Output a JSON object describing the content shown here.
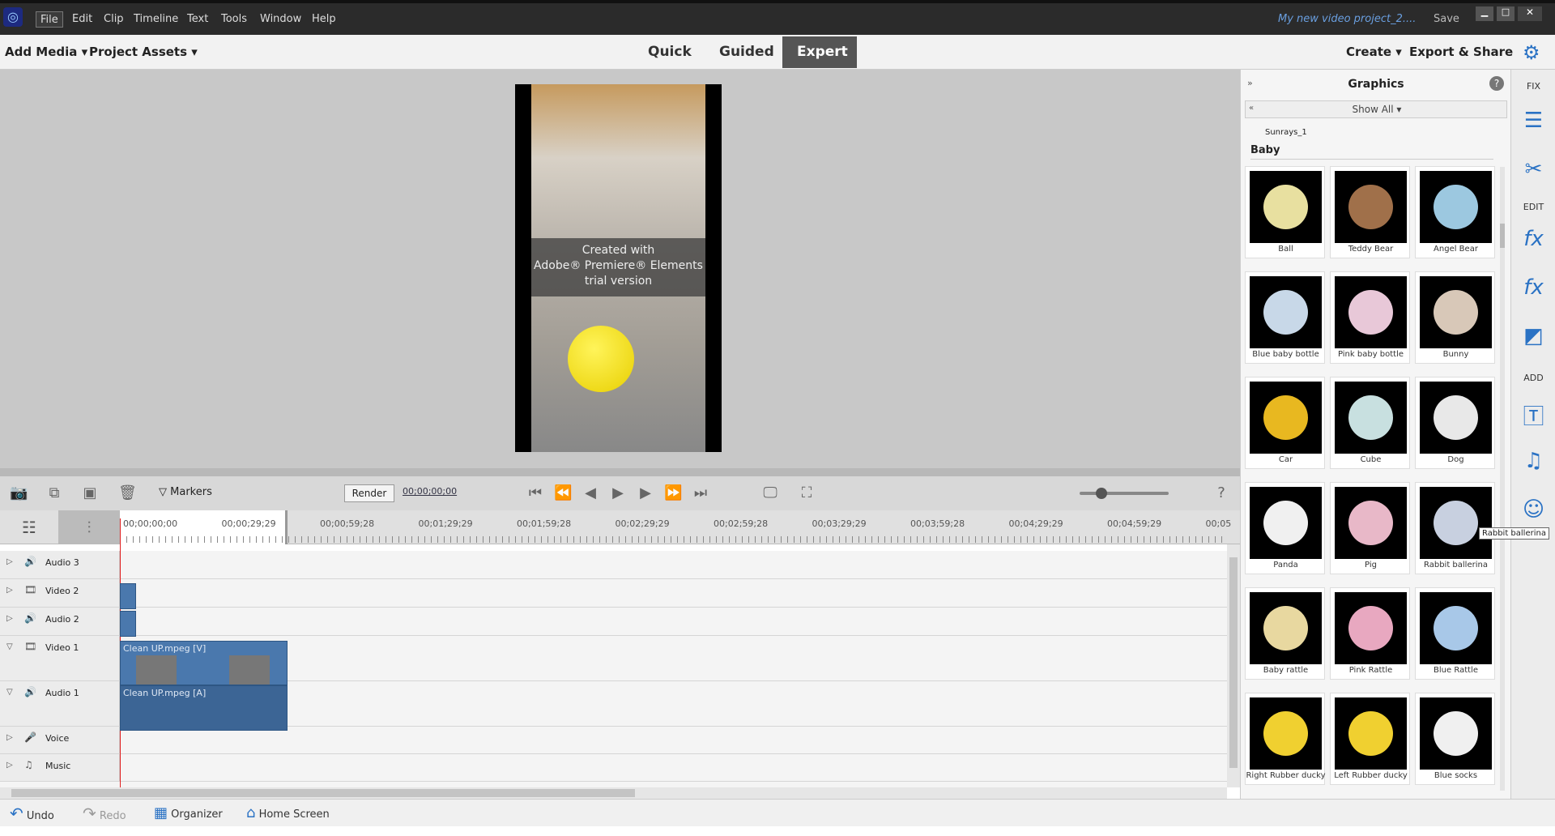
{
  "menu": [
    "File",
    "Edit",
    "Clip",
    "Timeline",
    "Text",
    "Tools",
    "Window",
    "Help"
  ],
  "title": {
    "project": "My new video project_2....",
    "save": "Save"
  },
  "toolbar": {
    "add_media": "Add Media ▾",
    "project_assets": "Project Assets ▾",
    "modes": [
      "Quick",
      "Guided",
      "Expert"
    ],
    "active_mode": "Expert",
    "create": "Create ▾",
    "export": "Export & Share"
  },
  "monitor": {
    "watermark": [
      "Created with",
      "Adobe® Premiere® Elements",
      "trial version"
    ]
  },
  "timeline": {
    "markers": "Markers",
    "render": "Render",
    "timecode": "00;00;00;00",
    "ticks": [
      "00;00;00;00",
      "00;00;29;29",
      "00;00;59;28",
      "00;01;29;29",
      "00;01;59;28",
      "00;02;29;29",
      "00;02;59;28",
      "00;03;29;29",
      "00;03;59;28",
      "00;04;29;29",
      "00;04;59;29",
      "00;05"
    ],
    "tracks": [
      {
        "name": "Audio 3",
        "icon": "speaker"
      },
      {
        "name": "Video 2",
        "icon": "film"
      },
      {
        "name": "Audio 2",
        "icon": "speaker"
      },
      {
        "name": "Video 1",
        "icon": "film"
      },
      {
        "name": "Audio 1",
        "icon": "speaker"
      },
      {
        "name": "Voice",
        "icon": "mic"
      },
      {
        "name": "Music",
        "icon": "note"
      }
    ],
    "clips": {
      "video": "Clean UP.mpeg [V]",
      "audio": "Clean UP.mpeg [A]"
    }
  },
  "status": {
    "undo": "Undo",
    "redo": "Redo",
    "organizer": "Organizer",
    "home": "Home Screen"
  },
  "graphics": {
    "title": "Graphics",
    "filter": "Show All ▾",
    "prev_item": "Sunrays_1",
    "category": "Baby",
    "items": [
      "Ball",
      "Teddy Bear",
      "Angel Bear",
      "Blue baby bottle",
      "Pink baby bottle",
      "Bunny",
      "Car",
      "Cube",
      "Dog",
      "Panda",
      "Pig",
      "Rabbit ballerina",
      "Baby rattle",
      "Pink Rattle",
      "Blue Rattle",
      "Right Rubber ducky",
      "Left Rubber ducky",
      "Blue socks"
    ],
    "tooltip": "Rabbit ballerina"
  },
  "rightstrip": {
    "fix": "FIX",
    "edit": "EDIT",
    "add": "ADD"
  },
  "colors": {
    "accent": "#2a72c4",
    "clip": "#4a78ad",
    "playhead": "#e02020"
  }
}
